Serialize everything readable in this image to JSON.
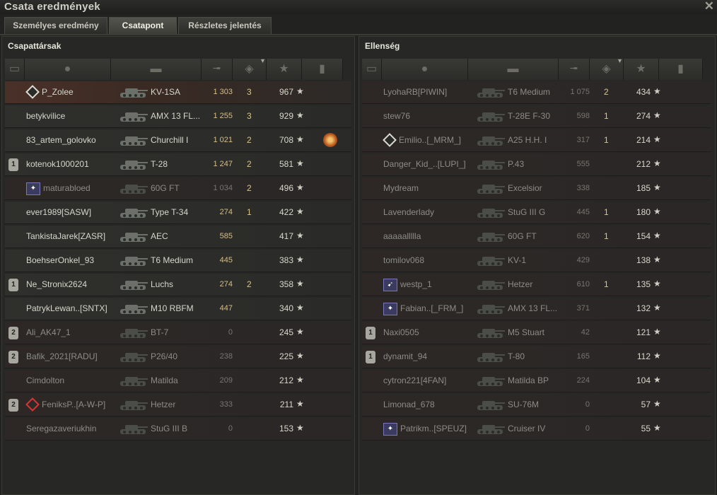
{
  "window": {
    "title": "Csata eredmények",
    "close_icon": "close-icon"
  },
  "tabs": [
    {
      "label": "Személyes eredmény",
      "active": false
    },
    {
      "label": "Csatapont",
      "active": true
    },
    {
      "label": "Részletes jelentés",
      "active": false
    }
  ],
  "team_left": {
    "title": "Csapattársak",
    "players": [
      {
        "name": "P_Zolee",
        "vehicle": "KV-1SA",
        "xp": "1 303",
        "kills": "3",
        "points": "967",
        "status": "self",
        "icon": "diamond",
        "medal": false,
        "badge": ""
      },
      {
        "name": "betykvilice",
        "vehicle": "AMX 13 FL...",
        "xp": "1 255",
        "kills": "3",
        "points": "929",
        "status": "alive",
        "icon": "",
        "medal": false,
        "badge": ""
      },
      {
        "name": "83_artem_golovko",
        "vehicle": "Churchill I",
        "xp": "1 021",
        "kills": "2",
        "points": "708",
        "status": "alive",
        "icon": "",
        "medal": true,
        "badge": ""
      },
      {
        "name": "kotenok1000201",
        "vehicle": "T-28",
        "xp": "1 247",
        "kills": "2",
        "points": "581",
        "status": "alive",
        "icon": "",
        "medal": false,
        "badge": "1"
      },
      {
        "name": "maturabloed",
        "vehicle": "60G FT",
        "xp": "1 034",
        "kills": "2",
        "points": "496",
        "status": "dead",
        "icon": "clan",
        "medal": false,
        "badge": ""
      },
      {
        "name": "ever1989[SASW]",
        "vehicle": "Type T-34",
        "xp": "274",
        "kills": "1",
        "points": "422",
        "status": "alive",
        "icon": "",
        "medal": false,
        "badge": ""
      },
      {
        "name": "TankistaJarek[ZASR]",
        "vehicle": "AEC",
        "xp": "585",
        "kills": "",
        "points": "417",
        "status": "alive",
        "icon": "",
        "medal": false,
        "badge": ""
      },
      {
        "name": "BoehserOnkel_93",
        "vehicle": "T6 Medium",
        "xp": "445",
        "kills": "",
        "points": "383",
        "status": "alive",
        "icon": "",
        "medal": false,
        "badge": ""
      },
      {
        "name": "Ne_Stronix2624",
        "vehicle": "Luchs",
        "xp": "274",
        "kills": "2",
        "points": "358",
        "status": "alive",
        "icon": "",
        "medal": false,
        "badge": "1"
      },
      {
        "name": "PatrykLewan..[SNTX]",
        "vehicle": "M10 RBFM",
        "xp": "447",
        "kills": "",
        "points": "340",
        "status": "alive",
        "icon": "",
        "medal": false,
        "badge": ""
      },
      {
        "name": "Ali_AK47_1",
        "vehicle": "BT-7",
        "xp": "0",
        "kills": "",
        "points": "245",
        "status": "dead",
        "icon": "",
        "medal": false,
        "badge": "2"
      },
      {
        "name": "Bafik_2021[RADU]",
        "vehicle": "P26/40",
        "xp": "238",
        "kills": "",
        "points": "225",
        "status": "dead",
        "icon": "",
        "medal": false,
        "badge": "2"
      },
      {
        "name": "Cimdolton",
        "vehicle": "Matilda",
        "xp": "209",
        "kills": "",
        "points": "212",
        "status": "dead",
        "icon": "",
        "medal": false,
        "badge": ""
      },
      {
        "name": "FeniksP..[A-W-P]",
        "vehicle": "Hetzer",
        "xp": "333",
        "kills": "",
        "points": "211",
        "status": "dead",
        "icon": "reddiamond",
        "medal": false,
        "badge": "2"
      },
      {
        "name": "Seregazaveriukhin",
        "vehicle": "StuG III B",
        "xp": "0",
        "kills": "",
        "points": "153",
        "status": "dead",
        "icon": "",
        "medal": false,
        "badge": ""
      }
    ]
  },
  "team_right": {
    "title": "Ellenség",
    "players": [
      {
        "name": "LyohaRB[PIWIN]",
        "vehicle": "T6 Medium",
        "xp": "1 075",
        "kills": "2",
        "points": "434",
        "status": "dead",
        "icon": "",
        "badge": ""
      },
      {
        "name": "stew76",
        "vehicle": "T-28E F-30",
        "xp": "598",
        "kills": "1",
        "points": "274",
        "status": "dead",
        "icon": "",
        "badge": ""
      },
      {
        "name": "Emilio..[_MRM_]",
        "vehicle": "A25 H.H. I",
        "xp": "317",
        "kills": "1",
        "points": "214",
        "status": "dead",
        "icon": "diamond",
        "badge": ""
      },
      {
        "name": "Danger_Kid_..[LUPI_]",
        "vehicle": "P.43",
        "xp": "555",
        "kills": "",
        "points": "212",
        "status": "dead",
        "icon": "",
        "badge": ""
      },
      {
        "name": "Mydream",
        "vehicle": "Excelsior",
        "xp": "338",
        "kills": "",
        "points": "185",
        "status": "dead",
        "icon": "",
        "badge": ""
      },
      {
        "name": "Lavenderlady",
        "vehicle": "StuG III G",
        "xp": "445",
        "kills": "1",
        "points": "180",
        "status": "dead",
        "icon": "",
        "badge": ""
      },
      {
        "name": "aaaaallllla",
        "vehicle": "60G FT",
        "xp": "620",
        "kills": "1",
        "points": "154",
        "status": "dead",
        "icon": "",
        "badge": ""
      },
      {
        "name": "tomilov068",
        "vehicle": "KV-1",
        "xp": "429",
        "kills": "",
        "points": "138",
        "status": "dead",
        "icon": "",
        "badge": ""
      },
      {
        "name": "westp_1",
        "vehicle": "Hetzer",
        "xp": "610",
        "kills": "1",
        "points": "135",
        "status": "dead",
        "icon": "clanarrow",
        "badge": ""
      },
      {
        "name": "Fabian..[_FRM_]",
        "vehicle": "AMX 13 FL...",
        "xp": "371",
        "kills": "",
        "points": "132",
        "status": "dead",
        "icon": "clan",
        "badge": ""
      },
      {
        "name": "Naxi0505",
        "vehicle": "M5 Stuart",
        "xp": "42",
        "kills": "",
        "points": "121",
        "status": "dead",
        "icon": "",
        "badge": "1"
      },
      {
        "name": "dynamit_94",
        "vehicle": "T-80",
        "xp": "165",
        "kills": "",
        "points": "112",
        "status": "dead",
        "icon": "",
        "badge": "1"
      },
      {
        "name": "cytron221[4FAN]",
        "vehicle": "Matilda BP",
        "xp": "224",
        "kills": "",
        "points": "104",
        "status": "dead",
        "icon": "",
        "badge": ""
      },
      {
        "name": "Limonad_678",
        "vehicle": "SU-76M",
        "xp": "0",
        "kills": "",
        "points": "57",
        "status": "dead",
        "icon": "",
        "badge": ""
      },
      {
        "name": "Patrikm..[SPEUZ]",
        "vehicle": "Cruiser IV",
        "xp": "0",
        "kills": "",
        "points": "55",
        "status": "dead",
        "icon": "clan",
        "badge": ""
      }
    ]
  },
  "header_icons": [
    "rank-icon",
    "player-icon",
    "tank-icon",
    "damage-icon",
    "kills-icon",
    "points-icon",
    "medal-icon"
  ],
  "star_glyph": "★"
}
